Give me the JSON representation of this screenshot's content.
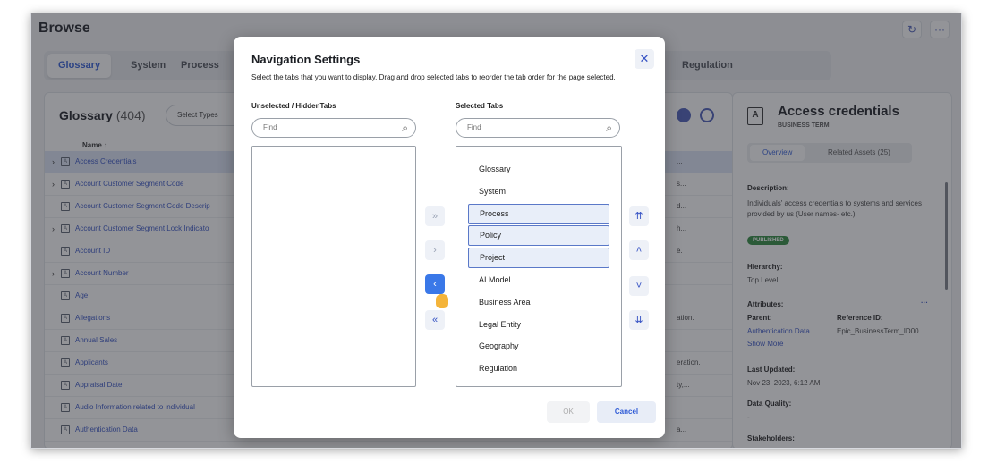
{
  "page": {
    "title": "Browse"
  },
  "header_buttons": {
    "refresh_icon": "↻",
    "more_icon": "···"
  },
  "tabs": [
    {
      "label": "Glossary",
      "active": true
    },
    {
      "label": "System"
    },
    {
      "label": "Process"
    },
    {
      "label": "Regulation"
    }
  ],
  "left_panel": {
    "title": "Glossary",
    "count": "(404)",
    "select_types_placeholder": "Select Types",
    "column_header": "Name ↑",
    "rows": [
      {
        "label": "Access Credentials",
        "expand": true,
        "selected": true,
        "trunc": "..."
      },
      {
        "label": "Account Customer Segment Code",
        "expand": true,
        "trunc": "s..."
      },
      {
        "label": "Account Customer Segment Code Descrip",
        "expand": false,
        "trunc": "d..."
      },
      {
        "label": "Account Customer Segment Lock Indicato",
        "expand": true,
        "trunc": "h..."
      },
      {
        "label": "Account ID",
        "expand": false,
        "trunc": "e."
      },
      {
        "label": "Account Number",
        "expand": true,
        "trunc": ""
      },
      {
        "label": "Age",
        "expand": false,
        "trunc": ""
      },
      {
        "label": "Allegations",
        "expand": false,
        "trunc": "ation."
      },
      {
        "label": "Annual Sales",
        "expand": false,
        "trunc": ""
      },
      {
        "label": "Applicants",
        "expand": false,
        "trunc": "eration."
      },
      {
        "label": "Appraisal Date",
        "expand": false,
        "trunc": "ty,..."
      },
      {
        "label": "Audio Information related to individual",
        "expand": false,
        "trunc": ""
      },
      {
        "label": "Authentication Data",
        "expand": false,
        "trunc": "a..."
      }
    ]
  },
  "right_panel": {
    "title": "Access credentials",
    "subtitle": "BUSINESS TERM",
    "tabs": [
      "Overview",
      "Related Assets (25)"
    ],
    "description_label": "Description:",
    "description": "Individuals' access credentials to systems and services provided by us (User names- etc.)",
    "status_badge": "PUBLISHED",
    "hierarchy_label": "Hierarchy:",
    "hierarchy": "Top Level",
    "attributes_label": "Attributes:",
    "attributes_more": "···",
    "parent_label": "Parent:",
    "parent_value": "Authentication Data",
    "reference_label": "Reference ID:",
    "reference_value": "Epic_BusinessTerm_ID00...",
    "show_more": "Show More",
    "last_updated_label": "Last Updated:",
    "last_updated": "Nov 23, 2023, 6:12 AM",
    "data_quality_label": "Data Quality:",
    "data_quality": "-",
    "stakeholders_label": "Stakeholders:"
  },
  "modal": {
    "title": "Navigation Settings",
    "description": "Select the tabs that you want to display. Drag and drop selected tabs to reorder the tab order for the page selected.",
    "unselected_label": "Unselected / HiddenTabs",
    "selected_label": "Selected Tabs",
    "find_placeholder": "Find",
    "selected_items": [
      {
        "label": "Glossary"
      },
      {
        "label": "System"
      },
      {
        "label": "Process",
        "highlighted": true
      },
      {
        "label": "Policy",
        "highlighted": true
      },
      {
        "label": "Project",
        "highlighted": true
      },
      {
        "label": "AI Model"
      },
      {
        "label": "Business Area"
      },
      {
        "label": "Legal Entity"
      },
      {
        "label": "Geography"
      },
      {
        "label": "Regulation"
      }
    ],
    "ok_label": "OK",
    "cancel_label": "Cancel"
  }
}
